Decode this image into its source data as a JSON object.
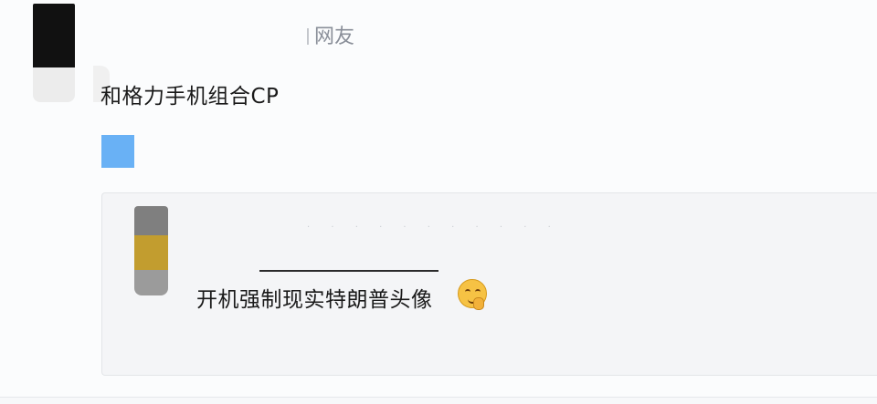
{
  "post": {
    "author_suffix": "网友",
    "text": "和格力手机组合CP",
    "icons": {
      "attachment": "image-placeholder-icon",
      "emoji": "smirk-hand-emoji-icon"
    },
    "colors": {
      "attachment": "#69b1f5",
      "quote_bg": "#f4f5f7"
    }
  },
  "quote": {
    "redacted_line": "· · · · ·  · ·  · · · ·",
    "text": "开机强制现实特朗普头像"
  }
}
